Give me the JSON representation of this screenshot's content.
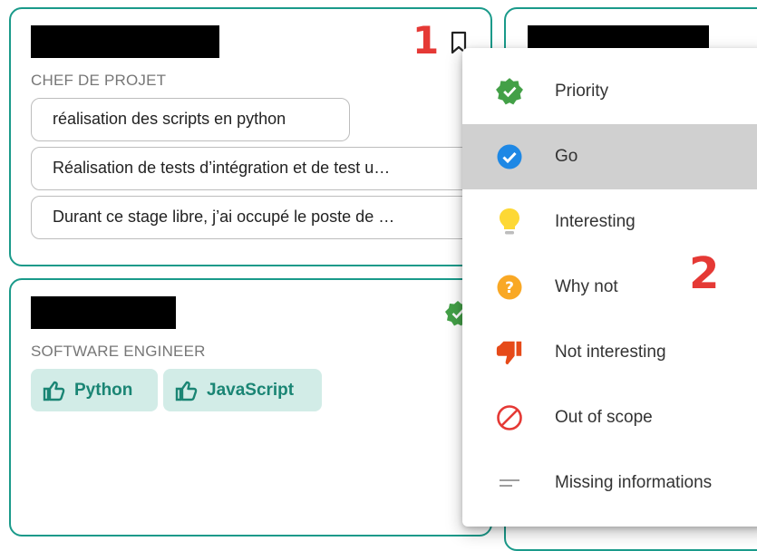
{
  "cards": [
    {
      "role": "CHEF DE PROJET",
      "chips": [
        "réalisation des scripts en python",
        "Réalisation de tests d’intégration et de test u…",
        "Durant ce stage libre, j’ai occupé le poste de …"
      ]
    },
    {
      "role": "SOFTWARE ENGINEER",
      "skills": [
        "Python",
        "JavaScript"
      ]
    }
  ],
  "annotations": {
    "one": "1",
    "two": "2"
  },
  "menu": {
    "items": [
      {
        "label": "Priority",
        "icon": "verified-badge-icon",
        "color": "#43a047"
      },
      {
        "label": "Go",
        "icon": "check-circle-icon",
        "color": "#1e88e5",
        "selected": true
      },
      {
        "label": "Interesting",
        "icon": "lightbulb-icon",
        "color": "#fdd835"
      },
      {
        "label": "Why not",
        "icon": "question-circle-icon",
        "color": "#f9a825"
      },
      {
        "label": "Not interesting",
        "icon": "thumb-down-icon",
        "color": "#e64a19"
      },
      {
        "label": "Out of scope",
        "icon": "block-icon",
        "color": "#e53935"
      },
      {
        "label": "Missing informations",
        "icon": "dash-icon",
        "color": "#9e9e9e"
      }
    ]
  },
  "colors": {
    "accent": "#1a9a8a",
    "skill_bg": "#d2ece7",
    "skill_text": "#1a8574"
  }
}
